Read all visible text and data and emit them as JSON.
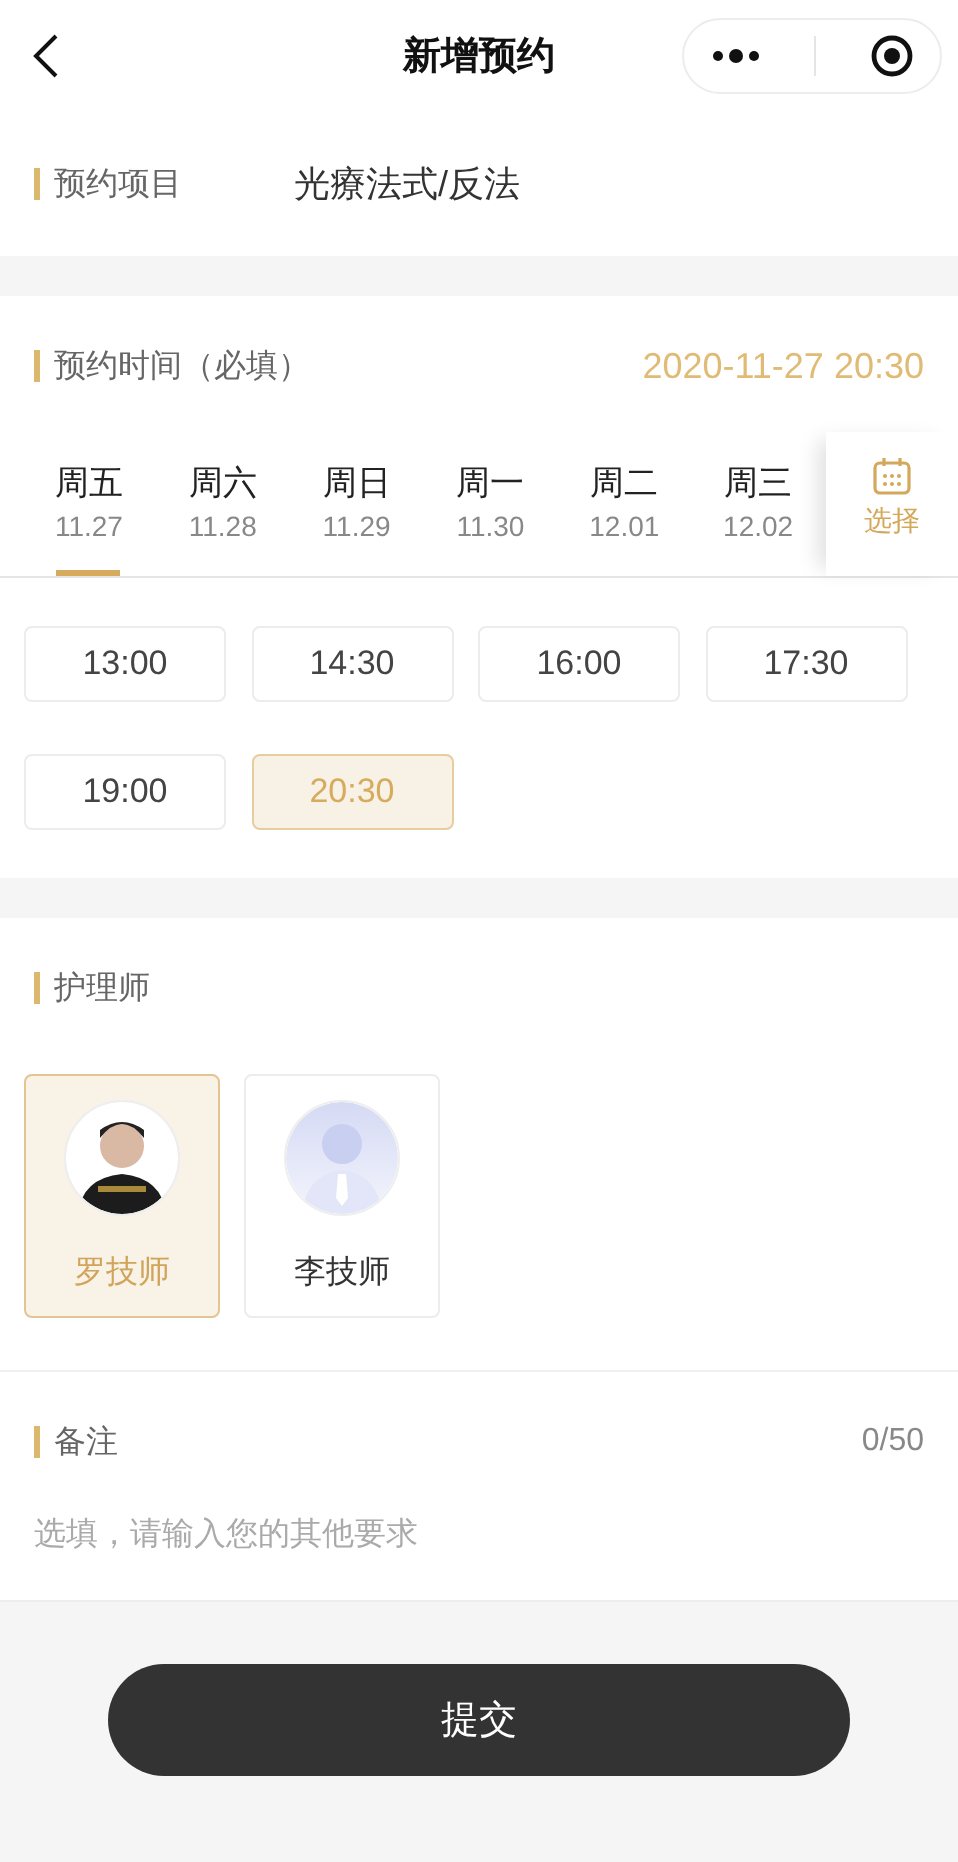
{
  "navbar": {
    "title": "新增预约"
  },
  "project": {
    "label": "预约项目",
    "value": "光療法式/反法"
  },
  "time": {
    "label": "预约时间（必填）",
    "value": "2020-11-27 20:30",
    "dates": [
      {
        "weekday": "周五",
        "date": "11.27",
        "selected": true
      },
      {
        "weekday": "周六",
        "date": "11.28",
        "selected": false
      },
      {
        "weekday": "周日",
        "date": "11.29",
        "selected": false
      },
      {
        "weekday": "周一",
        "date": "11.30",
        "selected": false
      },
      {
        "weekday": "周二",
        "date": "12.01",
        "selected": false
      },
      {
        "weekday": "周三",
        "date": "12.02",
        "selected": false
      }
    ],
    "choose_label": "选择",
    "slots": [
      {
        "time": "13:00",
        "selected": false
      },
      {
        "time": "14:30",
        "selected": false
      },
      {
        "time": "16:00",
        "selected": false
      },
      {
        "time": "17:30",
        "selected": false
      },
      {
        "time": "19:00",
        "selected": false
      },
      {
        "time": "20:30",
        "selected": true
      }
    ]
  },
  "nurse": {
    "label": "护理师",
    "staff": [
      {
        "name": "罗技师",
        "selected": true,
        "kind": "picture"
      },
      {
        "name": "李技师",
        "selected": false,
        "kind": "default"
      }
    ]
  },
  "remark": {
    "label": "备注",
    "count": "0/50",
    "placeholder": "选填，请输入您的其他要求"
  },
  "submit": "提交"
}
